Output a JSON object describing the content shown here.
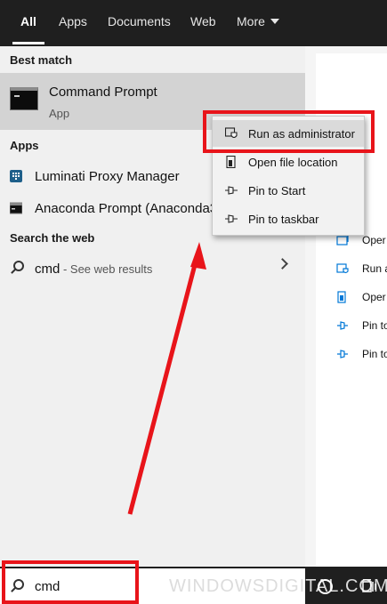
{
  "tabs": [
    {
      "label": "All",
      "active": true
    },
    {
      "label": "Apps",
      "active": false
    },
    {
      "label": "Documents",
      "active": false
    },
    {
      "label": "Web",
      "active": false
    },
    {
      "label": "More",
      "active": false
    }
  ],
  "best_match": {
    "section_label": "Best match",
    "title": "Command Prompt",
    "subtitle": "App"
  },
  "apps": {
    "section_label": "Apps",
    "items": [
      {
        "label": "Luminati Proxy Manager"
      },
      {
        "label": "Anaconda Prompt (Anaconda3"
      }
    ]
  },
  "search_web": {
    "section_label": "Search the web",
    "query": "cmd",
    "suffix": " - See web results"
  },
  "context_menu": {
    "items": [
      {
        "label": "Run as administrator",
        "icon": "shield-icon",
        "highlighted": true
      },
      {
        "label": "Open file location",
        "icon": "folder-icon"
      },
      {
        "label": "Pin to Start",
        "icon": "pin-icon"
      },
      {
        "label": "Pin to taskbar",
        "icon": "pin-icon"
      }
    ]
  },
  "right_panel": {
    "items": [
      {
        "label": "Oper",
        "icon": "open-icon"
      },
      {
        "label": "Run a",
        "icon": "shield-icon"
      },
      {
        "label": "Oper",
        "icon": "folder-icon"
      },
      {
        "label": "Pin to",
        "icon": "pin-icon"
      },
      {
        "label": "Pin to",
        "icon": "pin-icon"
      }
    ]
  },
  "taskbar": {
    "search_value": "cmd",
    "watermark": "WINDOWSDIGITAL.COM"
  },
  "colors": {
    "annotation_red": "#e8141a",
    "accent_blue": "#0078d7",
    "taskbar": "#1f1f1f"
  }
}
